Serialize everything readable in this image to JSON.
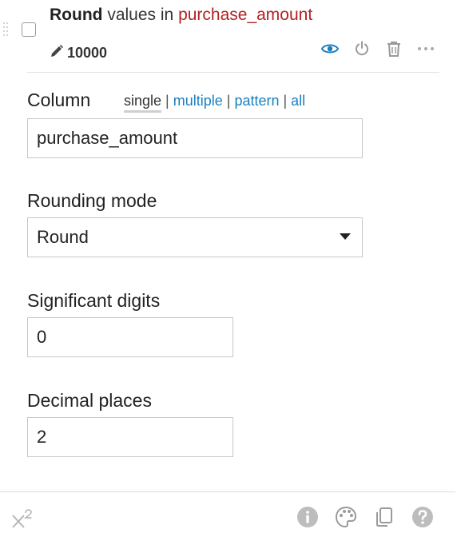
{
  "step": {
    "title_op": "Round",
    "title_mid": "values in",
    "title_column": "purchase_amount",
    "meta_value": "10000",
    "icons": [
      "drag-handle-icon",
      "eye-icon",
      "power-icon",
      "trash-icon",
      "more-icon",
      "pencil-icon"
    ],
    "accent_color": "#1a7fc0",
    "column_color": "#b22222"
  },
  "form": {
    "column_label": "Column",
    "column_modes": {
      "single": "single",
      "multiple": "multiple",
      "pattern": "pattern",
      "all": "all",
      "separator": "|"
    },
    "column_value": "purchase_amount",
    "rounding_mode_label": "Rounding mode",
    "rounding_mode_value": "Round",
    "significant_digits_label": "Significant digits",
    "significant_digits_value": "0",
    "decimal_places_label": "Decimal places",
    "decimal_places_value": "2"
  },
  "footer": {
    "left_icon": "superscript-icon",
    "right_icons": [
      "info-icon",
      "palette-icon",
      "copy-icon",
      "help-icon"
    ]
  }
}
